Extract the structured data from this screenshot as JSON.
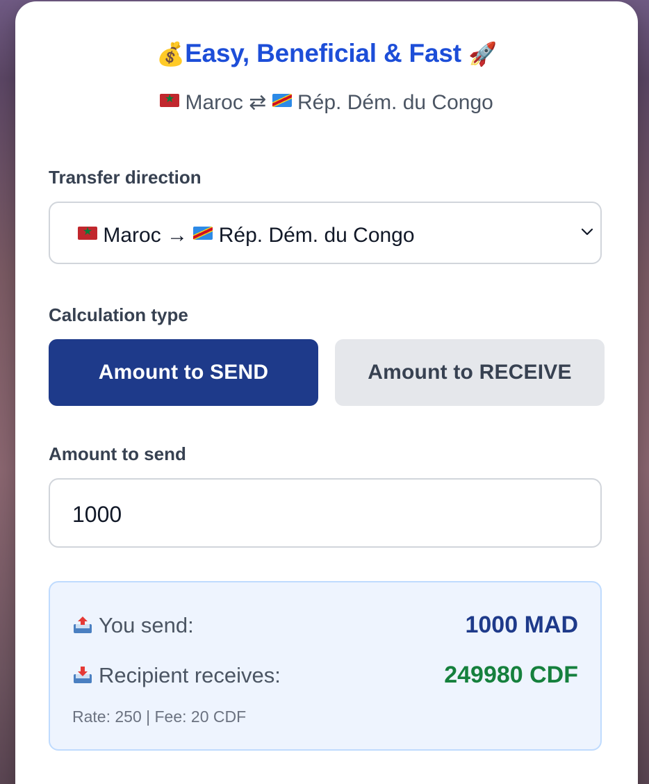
{
  "header": {
    "title_prefix_icon": "money-bag-icon",
    "title": "Easy, Beneficial & Fast",
    "title_suffix_icon": "rocket-icon",
    "subtitle_from": "Maroc",
    "subtitle_swap": "⇄",
    "subtitle_to": "Rép. Dém. du Congo"
  },
  "transfer": {
    "label": "Transfer direction",
    "selected_from": "Maroc",
    "arrow": "→",
    "selected_to": "Rép. Dém. du Congo"
  },
  "calculation": {
    "label": "Calculation type",
    "send_label": "Amount to SEND",
    "receive_label": "Amount to RECEIVE",
    "active": "send"
  },
  "amount": {
    "label": "Amount to send",
    "value": "1000"
  },
  "summary": {
    "send_label": "You send:",
    "send_value": "1000 MAD",
    "receive_label": "Recipient receives:",
    "receive_value": "249980 CDF",
    "rate_line": "Rate: 250 | Fee: 20 CDF"
  },
  "colors": {
    "title": "#1d4ed8",
    "active_button": "#1e3a8a",
    "receive_value": "#15803d",
    "summary_bg": "#eef4fe"
  }
}
